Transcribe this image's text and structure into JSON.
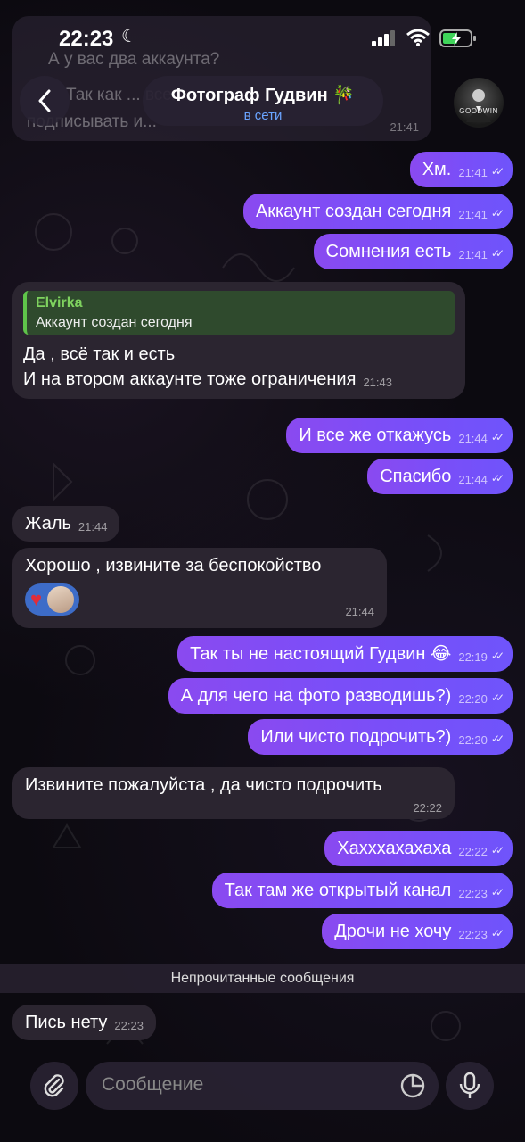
{
  "status_bar": {
    "time": "22:23"
  },
  "header": {
    "title": "Фотограф Гудвин",
    "title_emoji": "🎋",
    "subtitle": "в сети",
    "avatar_label": "GOODWIN"
  },
  "faded_message": {
    "line1": "А у вас два аккаунта?",
    "line2": "Так как ... всех",
    "line3": "подписывать и...",
    "time": "21:41"
  },
  "messages": [
    {
      "text": "Хм.",
      "time": "21:41"
    },
    {
      "text": "Аккаунт создан сегодня",
      "time": "21:41"
    },
    {
      "text": "Сомнения есть",
      "time": "21:41"
    },
    {
      "quote_name": "Elvirka",
      "quote_text": "Аккаунт создан сегодня",
      "line1": "Да , всё так и есть",
      "line2": "И на втором аккаунте тоже ограничения",
      "time": "21:43"
    },
    {
      "text": "И все же откажусь",
      "time": "21:44"
    },
    {
      "text": "Спасибо",
      "time": "21:44"
    },
    {
      "text": "Жаль",
      "time": "21:44"
    },
    {
      "text": "Хорошо  , извините за беспокойство",
      "time": "21:44"
    },
    {
      "text": "Так ты не настоящий Гудвин 😂",
      "time": "22:19"
    },
    {
      "text": "А для чего на фото разводишь?)",
      "time": "22:20"
    },
    {
      "text": "Или чисто подрочить?)",
      "time": "22:20"
    },
    {
      "text": "Извините пожалуйста  , да чисто подрочить",
      "time": "22:22"
    },
    {
      "text": "Хахххахахаха",
      "time": "22:22"
    },
    {
      "text": "Так там же открытый канал",
      "time": "22:23"
    },
    {
      "text": "Дрочи не хочу",
      "time": "22:23"
    },
    {
      "text": "Пись нету",
      "time": "22:23"
    }
  ],
  "unread_divider": "Непрочитанные сообщения",
  "input": {
    "placeholder": "Сообщение"
  },
  "colors": {
    "accent": "#7a4ef8",
    "link": "#6aa4ff",
    "quote_green": "#5fc44a",
    "reaction_blue": "#3d6cc8"
  }
}
